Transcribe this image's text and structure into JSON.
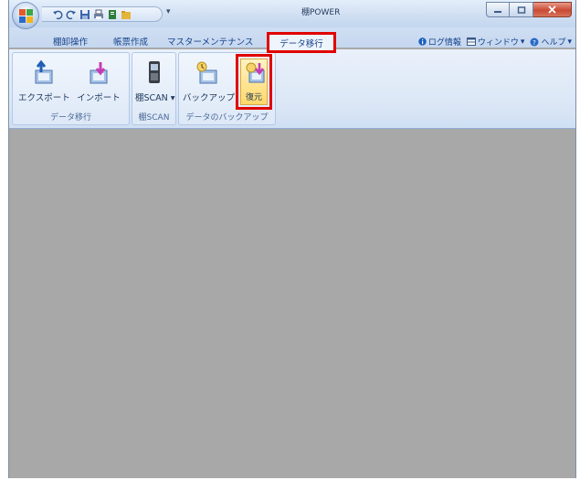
{
  "window": {
    "title": "棚POWER"
  },
  "tabs": [
    {
      "label": "棚卸操作"
    },
    {
      "label": "帳票作成"
    },
    {
      "label": "マスターメンテナンス"
    },
    {
      "label": "データ移行"
    }
  ],
  "right_menu": {
    "log_info": "ログ情報",
    "window": "ウィンドウ",
    "help": "ヘルプ"
  },
  "ribbon": {
    "groups": [
      {
        "label": "データ移行",
        "buttons": [
          {
            "label": "エクスポート",
            "icon": "export-icon"
          },
          {
            "label": "インポート",
            "icon": "import-icon"
          }
        ]
      },
      {
        "label": "棚SCAN",
        "buttons": [
          {
            "label": "棚SCAN",
            "icon": "handheld-scanner-icon"
          }
        ]
      },
      {
        "label": "データのバックアップ",
        "buttons": [
          {
            "label": "バックアップ",
            "icon": "backup-icon"
          },
          {
            "label": "復元",
            "icon": "restore-icon"
          }
        ]
      }
    ]
  },
  "colors": {
    "highlight": "#e00000",
    "workspace": "#a8a8a8",
    "ribbon": "#dbe7f6"
  }
}
